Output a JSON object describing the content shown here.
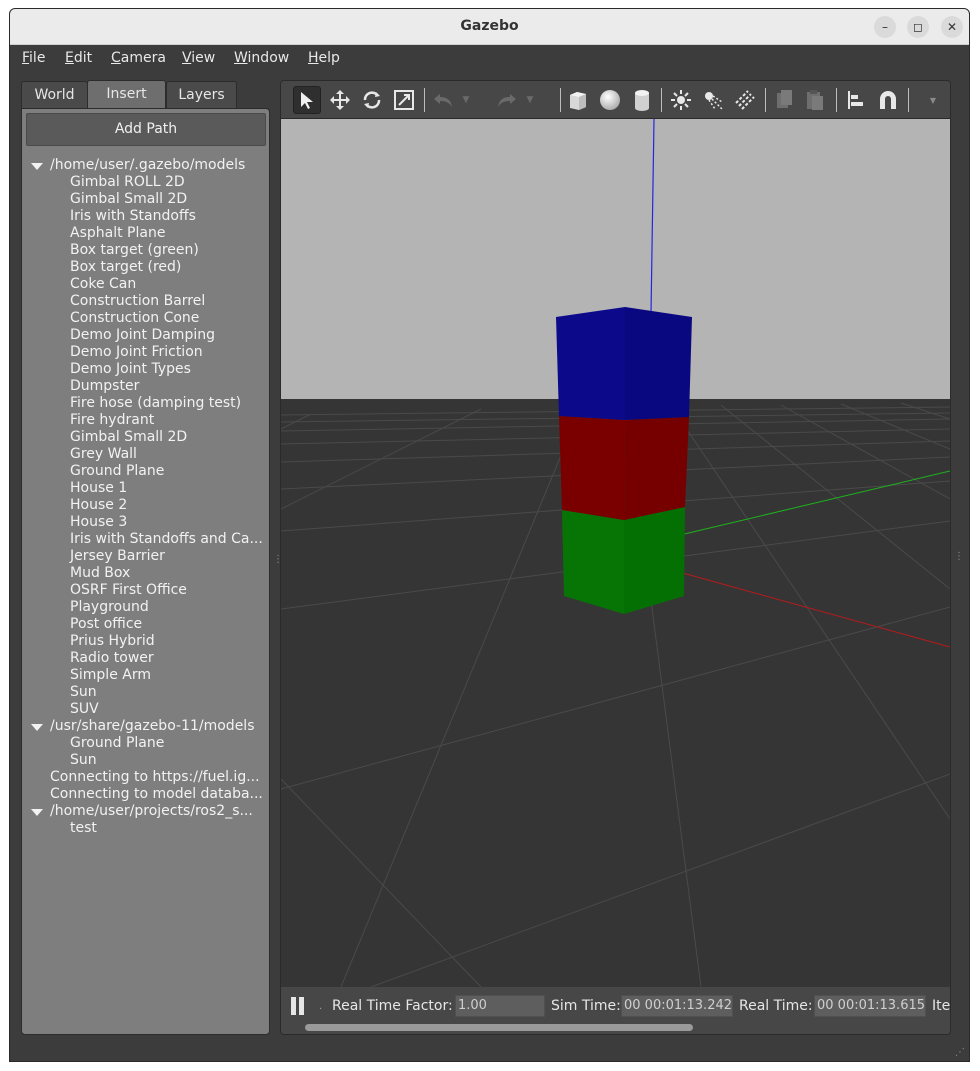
{
  "window": {
    "title": "Gazebo"
  },
  "menu": {
    "file": {
      "key": "F",
      "rest": "ile"
    },
    "edit": {
      "key": "E",
      "rest": "dit"
    },
    "camera": {
      "key": "C",
      "rest": "amera"
    },
    "view": {
      "key": "V",
      "rest": "iew"
    },
    "window": {
      "key": "W",
      "rest": "indow"
    },
    "help": {
      "key": "H",
      "rest": "elp"
    }
  },
  "tabs": {
    "world": "World",
    "insert": "Insert",
    "layers": "Layers"
  },
  "insert": {
    "add_path": "Add Path",
    "root1": "/home/user/.gazebo/models",
    "root1_items": [
      "Gimbal ROLL 2D",
      "Gimbal Small 2D",
      "Iris with Standoffs",
      "Asphalt Plane",
      "Box target (green)",
      "Box target (red)",
      "Coke Can",
      "Construction Barrel",
      "Construction Cone",
      "Demo Joint Damping",
      "Demo Joint Friction",
      "Demo Joint Types",
      "Dumpster",
      "Fire hose (damping test)",
      "Fire hydrant",
      "Gimbal Small 2D",
      "Grey Wall",
      "Ground Plane",
      "House 1",
      "House 2",
      "House 3",
      "Iris with Standoffs and Ca...",
      "Jersey Barrier",
      "Mud Box",
      "OSRF First Office",
      "Playground",
      "Post office",
      "Prius Hybrid",
      "Radio tower",
      "Simple Arm",
      "Sun",
      "SUV"
    ],
    "root2": "/usr/share/gazebo-11/models",
    "root2_items": [
      "Ground Plane",
      "Sun"
    ],
    "loose1": "Connecting to https://fuel.ig...",
    "loose2": "Connecting to model databa...",
    "root3": "/home/user/projects/ros2_s...",
    "root3_items": [
      "test"
    ]
  },
  "status": {
    "rtf_label": "Real Time Factor:",
    "rtf_value": "1.00",
    "sim_label": "Sim Time:",
    "sim_value": "00 00:01:13.242",
    "real_label": "Real Time:",
    "real_value": "00 00:01:13.615",
    "iter_label": "Ite"
  },
  "colors": {
    "box_top": "#0c0a8a",
    "box_mid": "#7a0000",
    "box_bottom": "#067506",
    "sky": "#b4b4b4",
    "ground": "#353535"
  }
}
